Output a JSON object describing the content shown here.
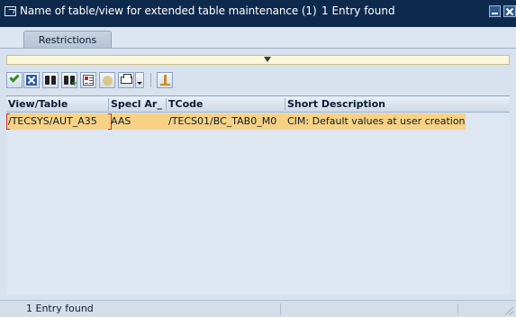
{
  "window": {
    "title": "Name of table/view for extended table maintenance (1)",
    "title_count": "1 Entry found"
  },
  "tabs": [
    {
      "label": "Restrictions"
    }
  ],
  "toolbar": {
    "buttons": [
      {
        "icon": "check-icon"
      },
      {
        "icon": "cancel-icon"
      },
      {
        "icon": "find-icon"
      },
      {
        "icon": "find-next-icon"
      },
      {
        "icon": "select-all-icon"
      },
      {
        "icon": "help-icon"
      },
      {
        "icon": "print-icon"
      },
      {
        "icon": "dropdown-icon"
      },
      {
        "icon": "pin-icon"
      }
    ]
  },
  "table": {
    "columns": [
      "View/Table",
      "Specl Ar_",
      "TCode",
      "Short Description"
    ],
    "rows": [
      {
        "view_table": "/TECSYS/AUT_A35",
        "specl_area": "AAS",
        "tcode": "/TECS01/BC_TAB0_M0",
        "short_description": "CIM: Default values at user creation"
      }
    ]
  },
  "status": {
    "text": "1 Entry found"
  },
  "colors": {
    "titlebar": "#0d2a4d",
    "selected_row": "#f7d284",
    "collapse_bar": "#fbf7d8"
  }
}
